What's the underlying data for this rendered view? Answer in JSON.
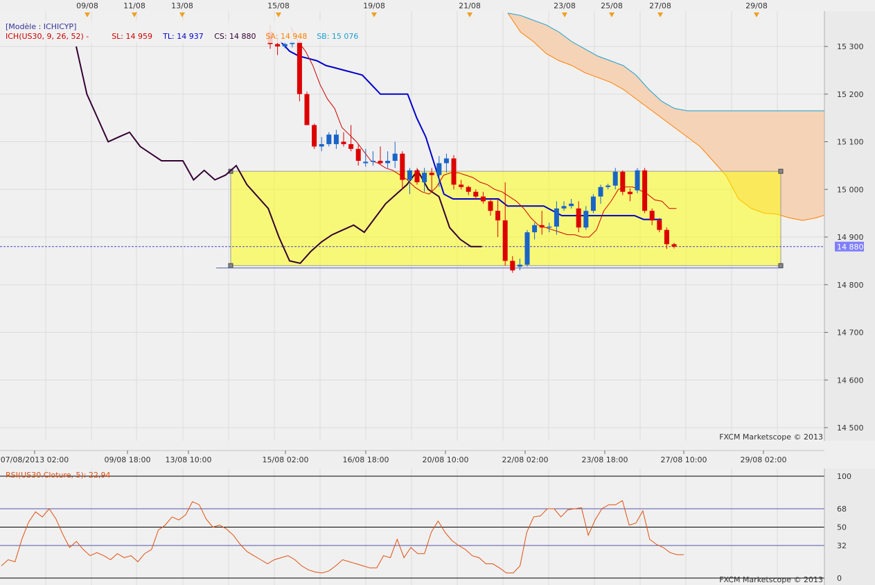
{
  "chart_data": [
    {
      "type": "candlestick",
      "model_label": "[Modèle : ICHICYP]",
      "legend": [
        {
          "text": "ICH(US30, 9, 26, 52) -",
          "color": "#cc0000"
        },
        {
          "text": "SL: 14 959",
          "color": "#cc0000"
        },
        {
          "text": "TL: 14 937",
          "color": "#0000cc"
        },
        {
          "text": "CS: 14 880",
          "color": "#330033"
        },
        {
          "text": "SA: 14 948",
          "color": "#ff8000"
        },
        {
          "text": "SB: 15 076",
          "color": "#1a9fd0"
        }
      ],
      "ylim": [
        14450,
        15360
      ],
      "y_ticks": [
        14500,
        14600,
        14700,
        14800,
        14900,
        15000,
        15100,
        15200,
        15300
      ],
      "y_tick_labels": [
        "14 500",
        "14 600",
        "14 700",
        "14 800",
        "14 900",
        "15 000",
        "15 100",
        "15 200",
        "15 300"
      ],
      "current_price": 14880,
      "current_price_label": "14 880",
      "x_tick_labels": [
        "07/08/2013 02:00",
        "09/08 18:00",
        "13/08 10:00",
        "15/08 02:00",
        "16/08 18:00",
        "20/08 10:00",
        "22/08 02:00",
        "23/08 18:00",
        "27/08 10:00",
        "29/08 02:00"
      ],
      "top_date_labels": [
        "09/08",
        "11/08",
        "13/08",
        "15/08",
        "19/08",
        "21/08",
        "23/08",
        "25/08",
        "27/08",
        "29/08"
      ],
      "watermark": "FXCM Marketscope © 2013",
      "candles": [
        {
          "o": 15330,
          "h": 15345,
          "l": 15295,
          "c": 15305
        },
        {
          "o": 15305,
          "h": 15318,
          "l": 15282,
          "c": 15300
        },
        {
          "o": 15300,
          "h": 15310,
          "l": 15296,
          "c": 15305
        },
        {
          "o": 15305,
          "h": 15312,
          "l": 15298,
          "c": 15309
        },
        {
          "o": 15310,
          "h": 15315,
          "l": 15185,
          "c": 15200
        },
        {
          "o": 15200,
          "h": 15205,
          "l": 15135,
          "c": 15135
        },
        {
          "o": 15135,
          "h": 15138,
          "l": 15085,
          "c": 15090
        },
        {
          "o": 15090,
          "h": 15110,
          "l": 15080,
          "c": 15095
        },
        {
          "o": 15095,
          "h": 15120,
          "l": 15090,
          "c": 15115
        },
        {
          "o": 15095,
          "h": 15125,
          "l": 15085,
          "c": 15115
        },
        {
          "o": 15100,
          "h": 15120,
          "l": 15090,
          "c": 15095
        },
        {
          "o": 15095,
          "h": 15135,
          "l": 15080,
          "c": 15085
        },
        {
          "o": 15085,
          "h": 15095,
          "l": 15050,
          "c": 15060
        },
        {
          "o": 15055,
          "h": 15085,
          "l": 15048,
          "c": 15058
        },
        {
          "o": 15058,
          "h": 15080,
          "l": 15050,
          "c": 15060
        },
        {
          "o": 15060,
          "h": 15090,
          "l": 15052,
          "c": 15055
        },
        {
          "o": 15055,
          "h": 15080,
          "l": 15045,
          "c": 15060
        },
        {
          "o": 15060,
          "h": 15100,
          "l": 15045,
          "c": 15075
        },
        {
          "o": 15075,
          "h": 15080,
          "l": 15000,
          "c": 15020
        },
        {
          "o": 15020,
          "h": 15045,
          "l": 14990,
          "c": 15040
        },
        {
          "o": 15040,
          "h": 15045,
          "l": 15010,
          "c": 15015
        },
        {
          "o": 15015,
          "h": 15045,
          "l": 14995,
          "c": 15035
        },
        {
          "o": 15035,
          "h": 15045,
          "l": 14995,
          "c": 15030
        },
        {
          "o": 15030,
          "h": 15070,
          "l": 15005,
          "c": 15055
        },
        {
          "o": 15055,
          "h": 15075,
          "l": 15035,
          "c": 15065
        },
        {
          "o": 15065,
          "h": 15072,
          "l": 15000,
          "c": 15010
        },
        {
          "o": 15010,
          "h": 15020,
          "l": 15000,
          "c": 15005
        },
        {
          "o": 15005,
          "h": 15008,
          "l": 14988,
          "c": 14995
        },
        {
          "o": 14995,
          "h": 15000,
          "l": 14978,
          "c": 14985
        },
        {
          "o": 14985,
          "h": 14995,
          "l": 14970,
          "c": 14975
        },
        {
          "o": 14975,
          "h": 14980,
          "l": 14945,
          "c": 14955
        },
        {
          "o": 14955,
          "h": 14980,
          "l": 14900,
          "c": 14935
        },
        {
          "o": 14935,
          "h": 15015,
          "l": 14840,
          "c": 14850
        },
        {
          "o": 14850,
          "h": 14860,
          "l": 14825,
          "c": 14830
        },
        {
          "o": 14838,
          "h": 14855,
          "l": 14830,
          "c": 14842
        },
        {
          "o": 14842,
          "h": 14915,
          "l": 14838,
          "c": 14910
        },
        {
          "o": 14910,
          "h": 14930,
          "l": 14895,
          "c": 14925
        },
        {
          "o": 14925,
          "h": 14955,
          "l": 14905,
          "c": 14920
        },
        {
          "o": 14920,
          "h": 14930,
          "l": 14910,
          "c": 14922
        },
        {
          "o": 14922,
          "h": 14975,
          "l": 14905,
          "c": 14960
        },
        {
          "o": 14960,
          "h": 14975,
          "l": 14955,
          "c": 14965
        },
        {
          "o": 14965,
          "h": 14980,
          "l": 14960,
          "c": 14970
        },
        {
          "o": 14960,
          "h": 14975,
          "l": 14910,
          "c": 14920
        },
        {
          "o": 14920,
          "h": 14965,
          "l": 14915,
          "c": 14955
        },
        {
          "o": 14955,
          "h": 14990,
          "l": 14950,
          "c": 14985
        },
        {
          "o": 14985,
          "h": 15010,
          "l": 14970,
          "c": 15005
        },
        {
          "o": 15005,
          "h": 15012,
          "l": 15000,
          "c": 15008
        },
        {
          "o": 15008,
          "h": 15045,
          "l": 15000,
          "c": 15037
        },
        {
          "o": 15037,
          "h": 15040,
          "l": 14988,
          "c": 14995
        },
        {
          "o": 14995,
          "h": 15002,
          "l": 14975,
          "c": 14990
        },
        {
          "o": 14998,
          "h": 15045,
          "l": 14992,
          "c": 15040
        },
        {
          "o": 15040,
          "h": 15045,
          "l": 14950,
          "c": 14955
        },
        {
          "o": 14955,
          "h": 14960,
          "l": 14925,
          "c": 14935
        },
        {
          "o": 14935,
          "h": 14940,
          "l": 14910,
          "c": 14915
        },
        {
          "o": 14915,
          "h": 14920,
          "l": 14875,
          "c": 14885
        },
        {
          "o": 14885,
          "h": 14888,
          "l": 14876,
          "c": 14880
        }
      ],
      "tenkan_sl": [
        15340,
        15310,
        15290,
        15260,
        15220,
        15190,
        15170,
        15130,
        15115,
        15100,
        15080,
        15060,
        15055,
        15045,
        15040,
        15030,
        15020,
        15005,
        14995,
        14990,
        15005,
        15030,
        15035,
        15035,
        15030,
        15025,
        15015,
        15010,
        15000,
        14995,
        14985,
        14975,
        14960,
        14940,
        14925,
        14920,
        14915,
        14910,
        14905,
        14905,
        14900,
        14900,
        14915,
        14955,
        14975,
        15000,
        15005,
        15005,
        14998,
        14990,
        14978,
        14975,
        14960,
        14960
      ],
      "kijun_tl": [
        15310,
        15290,
        15280,
        15275,
        15270,
        15260,
        15255,
        15250,
        15245,
        15240,
        15220,
        15200,
        15200,
        15200,
        15200,
        15150,
        15110,
        15050,
        14990,
        14980,
        14980,
        14980,
        14980,
        14980,
        14980,
        14965,
        14965,
        14965,
        14965,
        14965,
        14955,
        14945,
        14945,
        14945,
        14945,
        14945,
        14945,
        14945,
        14945,
        14945,
        14937,
        14937,
        14937
      ],
      "chikou_cs": [
        15300,
        15200,
        15150,
        15100,
        15110,
        15120,
        15090,
        15075,
        15060,
        15060,
        15060,
        15020,
        15040,
        15020,
        15030,
        15050,
        15010,
        14985,
        14960,
        14900,
        14850,
        14845,
        14870,
        14890,
        14905,
        14915,
        14925,
        14910,
        14940,
        14970,
        14990,
        15010,
        15040,
        15000,
        14985,
        14920,
        14895,
        14880,
        14880
      ],
      "senkou_a": [
        15370,
        15330,
        15310,
        15285,
        15270,
        15260,
        15245,
        15235,
        15225,
        15210,
        15190,
        15170,
        15150,
        15130,
        15110,
        15090,
        15060,
        15030,
        14980,
        14960,
        14950,
        14948,
        14940,
        14935,
        14940,
        14948
      ],
      "senkou_b": [
        15370,
        15365,
        15355,
        15345,
        15330,
        15310,
        15295,
        15280,
        15270,
        15260,
        15240,
        15210,
        15185,
        15170,
        15165,
        15165,
        15165,
        15165,
        15165,
        15165,
        15165,
        15165,
        15165,
        15165,
        15165,
        15165
      ],
      "rectangle": {
        "y_top": 15038,
        "y_bottom": 14840
      },
      "horizontal_line": 14838
    },
    {
      "type": "line",
      "legend": "RSI(US30.Cloture, 5): 22,94",
      "ylim": [
        0,
        100
      ],
      "levels": [
        100,
        68,
        50,
        32,
        0
      ],
      "level_labels": [
        "100",
        "68",
        "50",
        "32",
        "0"
      ],
      "watermark": "FXCM Marketscope © 2013",
      "rsi": [
        12,
        18,
        16,
        38,
        55,
        65,
        60,
        68,
        58,
        43,
        30,
        36,
        28,
        22,
        25,
        22,
        18,
        24,
        20,
        22,
        16,
        24,
        28,
        47,
        52,
        60,
        57,
        62,
        75,
        72,
        58,
        50,
        52,
        48,
        42,
        33,
        26,
        22,
        18,
        14,
        18,
        20,
        22,
        18,
        12,
        8,
        6,
        5,
        7,
        12,
        18,
        16,
        14,
        12,
        10,
        10,
        22,
        20,
        38,
        20,
        30,
        24,
        24,
        45,
        56,
        45,
        37,
        32,
        28,
        22,
        20,
        14,
        14,
        10,
        5,
        5,
        12,
        45,
        60,
        61,
        68,
        68,
        60,
        67,
        68,
        69,
        42,
        57,
        68,
        72,
        72,
        76,
        52,
        54,
        66,
        38,
        33,
        30,
        25,
        23,
        23
      ]
    }
  ]
}
